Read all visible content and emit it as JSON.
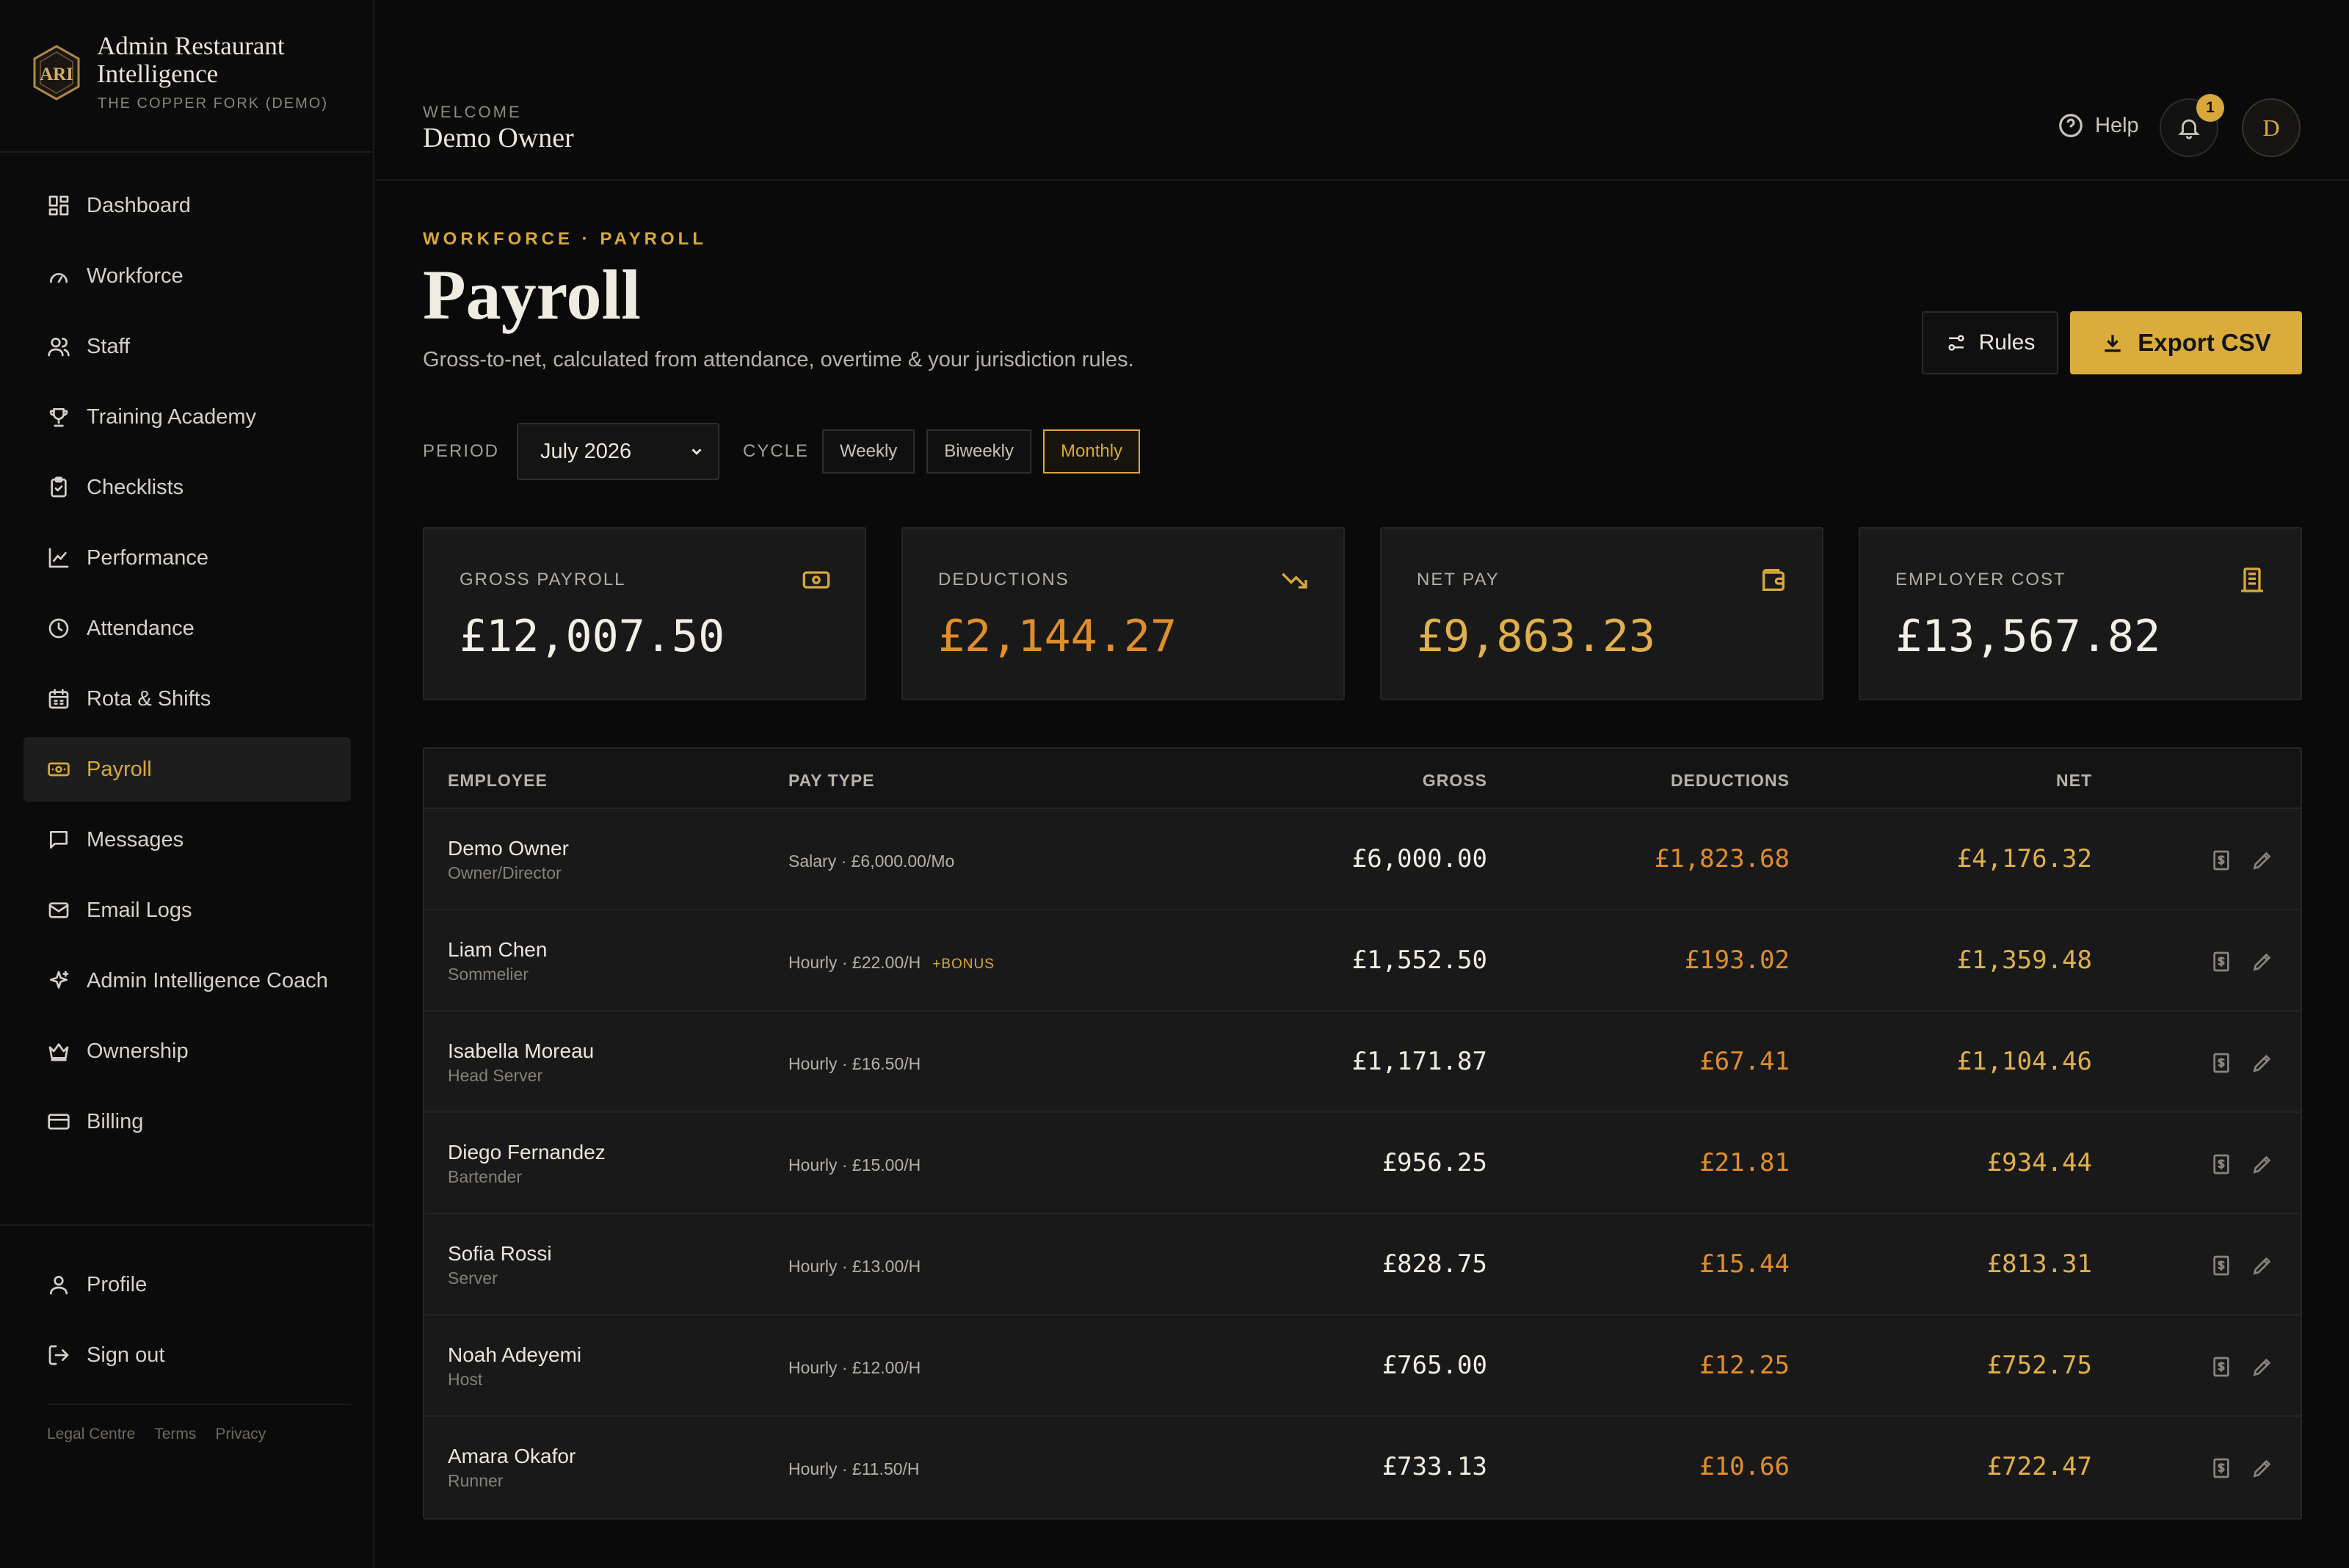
{
  "brand": {
    "name": "Admin Restaurant Intelligence",
    "subtitle": "THE COPPER FORK (DEMO)",
    "logo_text": "ARI"
  },
  "sidebar": {
    "items": [
      {
        "label": "Dashboard",
        "icon": "dashboard-icon",
        "active": false
      },
      {
        "label": "Workforce",
        "icon": "gauge-icon",
        "active": false
      },
      {
        "label": "Staff",
        "icon": "users-icon",
        "active": false
      },
      {
        "label": "Training Academy",
        "icon": "trophy-icon",
        "active": false
      },
      {
        "label": "Checklists",
        "icon": "clipboard-icon",
        "active": false
      },
      {
        "label": "Performance",
        "icon": "line-chart-icon",
        "active": false
      },
      {
        "label": "Attendance",
        "icon": "clock-icon",
        "active": false
      },
      {
        "label": "Rota & Shifts",
        "icon": "calendar-icon",
        "active": false
      },
      {
        "label": "Payroll",
        "icon": "banknote-icon",
        "active": true
      },
      {
        "label": "Messages",
        "icon": "message-icon",
        "active": false
      },
      {
        "label": "Email Logs",
        "icon": "mail-icon",
        "active": false
      },
      {
        "label": "Admin Intelligence Coach",
        "icon": "sparkle-icon",
        "active": false
      },
      {
        "label": "Ownership",
        "icon": "crown-icon",
        "active": false
      },
      {
        "label": "Billing",
        "icon": "credit-card-icon",
        "active": false
      }
    ],
    "bottom_items": [
      {
        "label": "Profile",
        "icon": "user-icon"
      },
      {
        "label": "Sign out",
        "icon": "sign-out-icon"
      }
    ],
    "legal": [
      "Legal Centre",
      "Terms",
      "Privacy"
    ]
  },
  "header": {
    "welcome_label": "WELCOME",
    "user_name": "Demo Owner",
    "help_label": "Help",
    "notification_count": "1",
    "avatar_initial": "D"
  },
  "page": {
    "breadcrumb": "WORKFORCE · PAYROLL",
    "title": "Payroll",
    "subtitle": "Gross-to-net, calculated from attendance, overtime & your jurisdiction rules.",
    "rules_label": "Rules",
    "export_label": "Export CSV"
  },
  "filters": {
    "period_label": "PERIOD",
    "period_value": "July 2026",
    "cycle_label": "CYCLE",
    "cycles": [
      {
        "label": "Weekly",
        "active": false
      },
      {
        "label": "Biweekly",
        "active": false
      },
      {
        "label": "Monthly",
        "active": true
      }
    ]
  },
  "summary": [
    {
      "label": "GROSS PAYROLL",
      "value": "£12,007.50",
      "icon": "banknote-icon",
      "tone": "white"
    },
    {
      "label": "DEDUCTIONS",
      "value": "£2,144.27",
      "icon": "trending-down-icon",
      "tone": "orange"
    },
    {
      "label": "NET PAY",
      "value": "£9,863.23",
      "icon": "wallet-icon",
      "tone": "gold"
    },
    {
      "label": "EMPLOYER COST",
      "value": "£13,567.82",
      "icon": "building-icon",
      "tone": "white"
    }
  ],
  "table": {
    "headers": {
      "employee": "EMPLOYEE",
      "pay_type": "PAY TYPE",
      "gross": "GROSS",
      "deductions": "DEDUCTIONS",
      "net": "NET"
    },
    "rows": [
      {
        "name": "Demo Owner",
        "role": "Owner/Director",
        "pay_type": "Salary · £6,000.00/Mo",
        "bonus": "",
        "gross": "£6,000.00",
        "deductions": "£1,823.68",
        "net": "£4,176.32"
      },
      {
        "name": "Liam Chen",
        "role": "Sommelier",
        "pay_type": "Hourly · £22.00/H",
        "bonus": "+BONUS",
        "gross": "£1,552.50",
        "deductions": "£193.02",
        "net": "£1,359.48"
      },
      {
        "name": "Isabella Moreau",
        "role": "Head Server",
        "pay_type": "Hourly · £16.50/H",
        "bonus": "",
        "gross": "£1,171.87",
        "deductions": "£67.41",
        "net": "£1,104.46"
      },
      {
        "name": "Diego Fernandez",
        "role": "Bartender",
        "pay_type": "Hourly · £15.00/H",
        "bonus": "",
        "gross": "£956.25",
        "deductions": "£21.81",
        "net": "£934.44"
      },
      {
        "name": "Sofia Rossi",
        "role": "Server",
        "pay_type": "Hourly · £13.00/H",
        "bonus": "",
        "gross": "£828.75",
        "deductions": "£15.44",
        "net": "£813.31"
      },
      {
        "name": "Noah Adeyemi",
        "role": "Host",
        "pay_type": "Hourly · £12.00/H",
        "bonus": "",
        "gross": "£765.00",
        "deductions": "£12.25",
        "net": "£752.75"
      },
      {
        "name": "Amara Okafor",
        "role": "Runner",
        "pay_type": "Hourly · £11.50/H",
        "bonus": "",
        "gross": "£733.13",
        "deductions": "£10.66",
        "net": "£722.47"
      }
    ]
  },
  "colors": {
    "accent": "#d8a83a",
    "deduction": "#e08e2c",
    "background": "#0a0a0a",
    "card": "#191919"
  }
}
